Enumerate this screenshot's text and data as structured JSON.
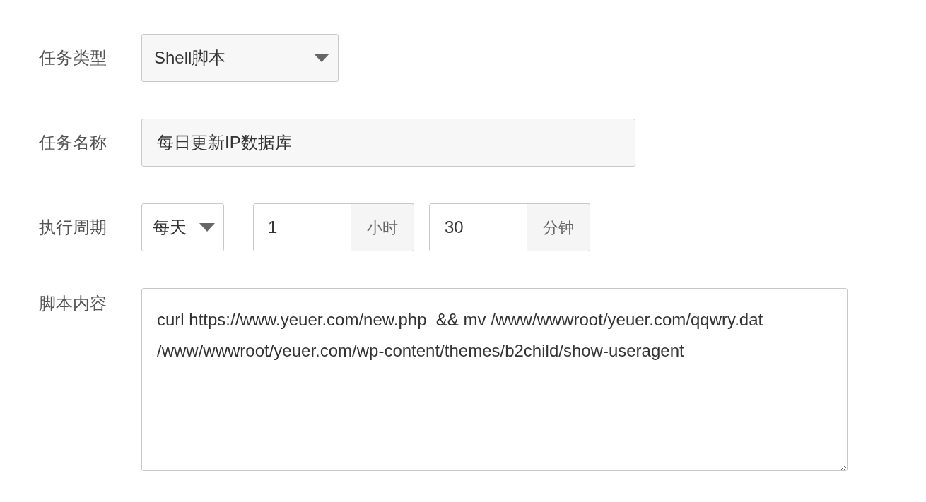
{
  "form": {
    "rows": [
      {
        "kind": "select",
        "label": "任务类型",
        "value": "Shell脚本"
      },
      {
        "kind": "text",
        "label": "任务名称",
        "value": "每日更新IP数据库"
      },
      {
        "kind": "period",
        "label": "执行周期",
        "period": "每天",
        "hours": "1",
        "hours_unit": "小时",
        "minutes": "30",
        "minutes_unit": "分钟"
      },
      {
        "kind": "textarea",
        "label": "脚本内容",
        "value": "curl https://www.yeuer.com/new.php  && mv /www/wwwroot/yeuer.com/qqwry.dat /www/wwwroot/yeuer.com/wp-content/themes/b2child/show-useragent"
      }
    ]
  }
}
